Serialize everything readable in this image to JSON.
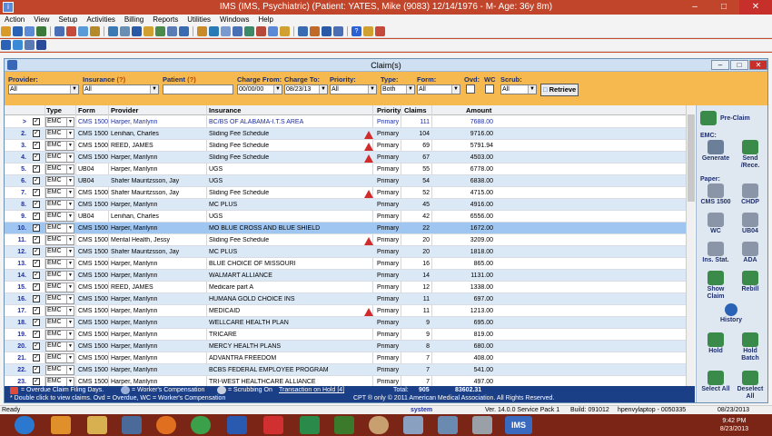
{
  "window": {
    "title": "IMS (IMS, Psychiatric)    (Patient: YATES, Mike  (9083) 12/14/1976 - M- Age: 36y 8m)"
  },
  "menu": [
    "Action",
    "View",
    "Setup",
    "Activities",
    "Billing",
    "Reports",
    "Utilities",
    "Windows",
    "Help"
  ],
  "claims_window": {
    "title": "Claim(s)"
  },
  "filters": {
    "provider_label": "Provider:",
    "provider_value": "All",
    "insurance_label": "Insurance",
    "insurance_q": "(?)",
    "insurance_value": "All",
    "patient_label": "Patient",
    "patient_q": "(?)",
    "patient_value": "",
    "charge_from_label": "Charge From:",
    "charge_from_value": "00/00/00",
    "charge_to_label": "Charge To:",
    "charge_to_value": "08/23/13",
    "priority_label": "Priority:",
    "priority_value": "All",
    "type_label": "Type:",
    "type_value": "Both",
    "form_label": "Form:",
    "form_value": "All",
    "ovd_label": "Ovd:",
    "wc_label": "WC",
    "scrub_label": "Scrub:",
    "scrub_value": "All",
    "retrieve_label": "Retrieve"
  },
  "grid": {
    "headers": {
      "type": "Type",
      "form": "Form",
      "provider": "Provider",
      "insurance": "Insurance",
      "priority": "Priority",
      "claims": "Claims",
      "amount": "Amount"
    },
    "rows": [
      {
        "num": ">",
        "type": "EMC",
        "form": "CMS 1500",
        "provider": "Harper, Marilynn",
        "insurance": "BC/BS OF ALABAMA-I.T.S AREA",
        "warn": false,
        "priority": "Primary",
        "claims": "111",
        "amount": "7688.00"
      },
      {
        "num": "2.",
        "type": "EMC",
        "form": "CMS 1500",
        "provider": "Lenihan, Charles",
        "insurance": "Sliding Fee Schedule",
        "warn": true,
        "priority": "Primary",
        "claims": "104",
        "amount": "9716.00"
      },
      {
        "num": "3.",
        "type": "EMC",
        "form": "CMS 1500",
        "provider": "REED, JAMES",
        "insurance": "Sliding Fee Schedule",
        "warn": true,
        "priority": "Primary",
        "claims": "69",
        "amount": "5791.94"
      },
      {
        "num": "4.",
        "type": "EMC",
        "form": "CMS 1500",
        "provider": "Harper, Marilynn",
        "insurance": "Sliding Fee Schedule",
        "warn": true,
        "priority": "Primary",
        "claims": "67",
        "amount": "4503.00"
      },
      {
        "num": "5.",
        "type": "EMC",
        "form": "UB04",
        "provider": "Harper, Marilynn",
        "insurance": "UGS",
        "warn": false,
        "priority": "Primary",
        "claims": "55",
        "amount": "6778.00"
      },
      {
        "num": "6.",
        "type": "EMC",
        "form": "UB04",
        "provider": "Shafer Mauritzsson, Jay",
        "insurance": "UGS",
        "warn": false,
        "priority": "Primary",
        "claims": "54",
        "amount": "6838.00"
      },
      {
        "num": "7.",
        "type": "EMC",
        "form": "CMS 1500",
        "provider": "Shafer Mauritzsson, Jay",
        "insurance": "Sliding Fee Schedule",
        "warn": true,
        "priority": "Primary",
        "claims": "52",
        "amount": "4715.00"
      },
      {
        "num": "8.",
        "type": "EMC",
        "form": "CMS 1500",
        "provider": "Harper, Marilynn",
        "insurance": "MC PLUS",
        "warn": false,
        "priority": "Primary",
        "claims": "45",
        "amount": "4916.00"
      },
      {
        "num": "9.",
        "type": "EMC",
        "form": "UB04",
        "provider": "Lenihan, Charles",
        "insurance": "UGS",
        "warn": false,
        "priority": "Primary",
        "claims": "42",
        "amount": "6556.00"
      },
      {
        "num": "10.",
        "type": "EMC",
        "form": "CMS 1500",
        "provider": "Harper, Marilynn",
        "insurance": "MO BLUE CROSS AND BLUE SHIELD",
        "warn": false,
        "priority": "Primary",
        "claims": "22",
        "amount": "1672.00"
      },
      {
        "num": "11.",
        "type": "EMC",
        "form": "CMS 1500",
        "provider": "Mental Health, Jessy",
        "insurance": "Sliding Fee Schedule",
        "warn": true,
        "priority": "Primary",
        "claims": "20",
        "amount": "3209.00"
      },
      {
        "num": "12.",
        "type": "EMC",
        "form": "CMS 1500",
        "provider": "Shafer Mauritzsson, Jay",
        "insurance": "MC PLUS",
        "warn": false,
        "priority": "Primary",
        "claims": "20",
        "amount": "1818.00"
      },
      {
        "num": "13.",
        "type": "EMC",
        "form": "CMS 1500",
        "provider": "Harper, Marilynn",
        "insurance": "BLUE CHOICE OF MISSOURI",
        "warn": false,
        "priority": "Primary",
        "claims": "16",
        "amount": "865.00"
      },
      {
        "num": "14.",
        "type": "EMC",
        "form": "CMS 1500",
        "provider": "Harper, Marilynn",
        "insurance": "WALMART ALLIANCE",
        "warn": false,
        "priority": "Primary",
        "claims": "14",
        "amount": "1131.00"
      },
      {
        "num": "15.",
        "type": "EMC",
        "form": "CMS 1500",
        "provider": "REED, JAMES",
        "insurance": "Medicare part A",
        "warn": false,
        "priority": "Primary",
        "claims": "12",
        "amount": "1338.00"
      },
      {
        "num": "16.",
        "type": "EMC",
        "form": "CMS 1500",
        "provider": "Harper, Marilynn",
        "insurance": "HUMANA GOLD CHOICE INS",
        "warn": false,
        "priority": "Primary",
        "claims": "11",
        "amount": "697.00"
      },
      {
        "num": "17.",
        "type": "EMC",
        "form": "CMS 1500",
        "provider": "Harper, Marilynn",
        "insurance": "MEDICAID",
        "warn": true,
        "priority": "Primary",
        "claims": "11",
        "amount": "1213.00"
      },
      {
        "num": "18.",
        "type": "EMC",
        "form": "CMS 1500",
        "provider": "Harper, Marilynn",
        "insurance": "WELLCARE HEALTH PLAN",
        "warn": false,
        "priority": "Primary",
        "claims": "9",
        "amount": "695.00"
      },
      {
        "num": "19.",
        "type": "EMC",
        "form": "CMS 1500",
        "provider": "Harper, Marilynn",
        "insurance": "TRICARE",
        "warn": false,
        "priority": "Primary",
        "claims": "9",
        "amount": "819.00"
      },
      {
        "num": "20.",
        "type": "EMC",
        "form": "CMS 1500",
        "provider": "Harper, Marilynn",
        "insurance": "MERCY HEALTH PLANS",
        "warn": false,
        "priority": "Primary",
        "claims": "8",
        "amount": "680.00"
      },
      {
        "num": "21.",
        "type": "EMC",
        "form": "CMS 1500",
        "provider": "Harper, Marilynn",
        "insurance": "ADVANTRA FREEDOM",
        "warn": false,
        "priority": "Primary",
        "claims": "7",
        "amount": "408.00"
      },
      {
        "num": "22.",
        "type": "EMC",
        "form": "CMS 1500",
        "provider": "Harper, Marilynn",
        "insurance": "BCBS FEDERAL EMPLOYEE PROGRAM",
        "warn": false,
        "priority": "Primary",
        "claims": "7",
        "amount": "541.00"
      },
      {
        "num": "23.",
        "type": "EMC",
        "form": "CMS 1500",
        "provider": "Harper, Marilynn",
        "insurance": "TRI-WEST HEALTHCARE ALLIANCE",
        "warn": false,
        "priority": "Primary",
        "claims": "7",
        "amount": "497.00"
      }
    ]
  },
  "legend": {
    "overdue": "= Overdue Claim Filing Days.",
    "wc": "= Worker's Compensation",
    "scrub": "= Scrubbing On",
    "hold": "Transaction on Hold [4]",
    "total_label": "Total:",
    "total_claims": "905",
    "total_amount": "83602.31",
    "line2": "* Double click to view claims.   Ovd = Overdue, WC = Worker's Compensation",
    "copyright": "CPT ® only © 2011 American Medical Association. All Rights Reserved."
  },
  "sidebar": {
    "pre_claim": "Pre-Claim",
    "emc_label": "EMC:",
    "generate": "Generate",
    "send_rece": "Send /Rece.",
    "paper_label": "Paper:",
    "cms1500": "CMS 1500",
    "chdp": "CHDP",
    "wc": "WC",
    "ub04": "UB04",
    "ins_stat": "Ins. Stat.",
    "ada": "ADA",
    "show_claim": "Show Claim",
    "rebill": "Rebill",
    "history": "History",
    "hold": "Hold",
    "hold_batch": "Hold Batch",
    "select_all": "Select All",
    "deselect_all": "Deselect All"
  },
  "statusbar": {
    "ready": "Ready",
    "system": "system",
    "version": "Ver. 14.0.0 Service Pack 1",
    "build": "Build: 091012",
    "host": "hpenvylaptop - 0050335",
    "date": "08/23/2013"
  },
  "taskbar": {
    "time": "9:42 PM",
    "date": "8/23/2013",
    "ims_label": "IMS"
  }
}
